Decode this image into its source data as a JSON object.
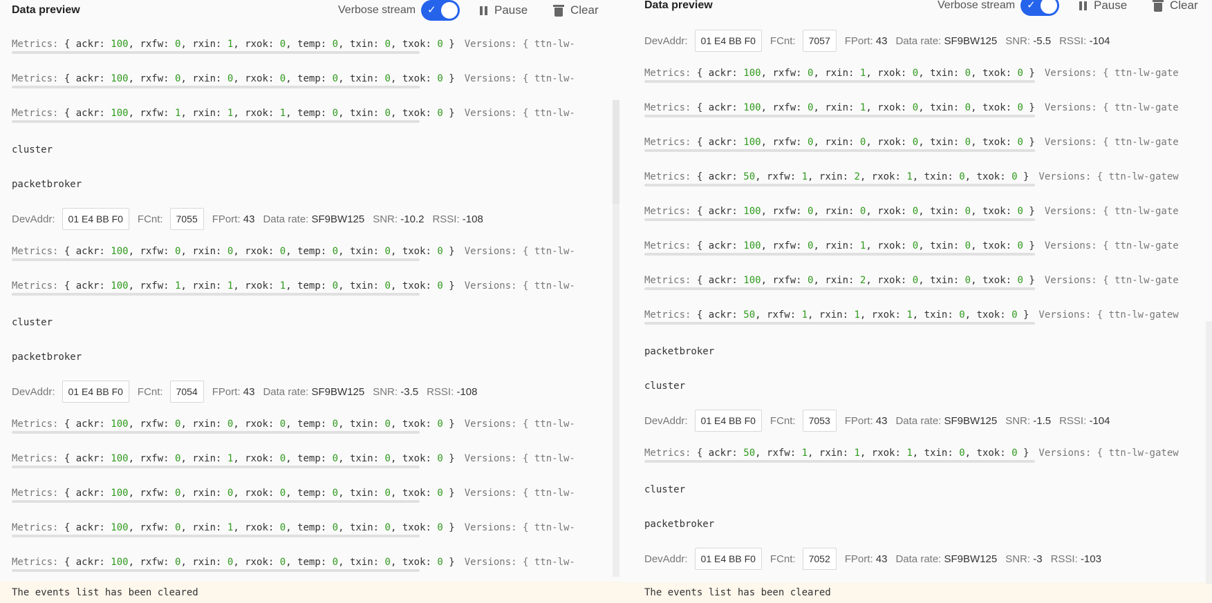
{
  "left_pane": {
    "title": "Data preview",
    "verbose_label": "Verbose stream",
    "pause_label": "Pause",
    "clear_label": "Clear",
    "notice": "The events list has been cleared",
    "events": [
      {
        "type": "metrics",
        "ackr": "100",
        "rxfw": "0",
        "rxin": "1",
        "rxok": "0",
        "temp": "0",
        "txin": "0",
        "txok": "0",
        "versions": "Versions: { ttn-lw-"
      },
      {
        "type": "metrics",
        "ackr": "100",
        "rxfw": "0",
        "rxin": "0",
        "rxok": "0",
        "temp": "0",
        "txin": "0",
        "txok": "0",
        "versions": "Versions: { ttn-lw-"
      },
      {
        "type": "metrics",
        "ackr": "100",
        "rxfw": "1",
        "rxin": "1",
        "rxok": "1",
        "temp": "0",
        "txin": "0",
        "txok": "0",
        "versions": "Versions: { ttn-lw-"
      },
      {
        "type": "text",
        "text": "cluster"
      },
      {
        "type": "text",
        "text": "packetbroker"
      },
      {
        "type": "dev",
        "devaddr": "01 E4 BB F0",
        "fcnt": "7055",
        "fport": "43",
        "datarate": "SF9BW125",
        "snr": "-10.2",
        "rssi": "-108"
      },
      {
        "type": "metrics",
        "ackr": "100",
        "rxfw": "0",
        "rxin": "0",
        "rxok": "0",
        "temp": "0",
        "txin": "0",
        "txok": "0",
        "versions": "Versions: { ttn-lw-"
      },
      {
        "type": "metrics",
        "ackr": "100",
        "rxfw": "1",
        "rxin": "1",
        "rxok": "1",
        "temp": "0",
        "txin": "0",
        "txok": "0",
        "versions": "Versions: { ttn-lw-"
      },
      {
        "type": "text",
        "text": "cluster"
      },
      {
        "type": "text",
        "text": "packetbroker"
      },
      {
        "type": "dev",
        "devaddr": "01 E4 BB F0",
        "fcnt": "7054",
        "fport": "43",
        "datarate": "SF9BW125",
        "snr": "-3.5",
        "rssi": "-108"
      },
      {
        "type": "metrics",
        "ackr": "100",
        "rxfw": "0",
        "rxin": "0",
        "rxok": "0",
        "temp": "0",
        "txin": "0",
        "txok": "0",
        "versions": "Versions: { ttn-lw-"
      },
      {
        "type": "metrics",
        "ackr": "100",
        "rxfw": "0",
        "rxin": "1",
        "rxok": "0",
        "temp": "0",
        "txin": "0",
        "txok": "0",
        "versions": "Versions: { ttn-lw-"
      },
      {
        "type": "metrics",
        "ackr": "100",
        "rxfw": "0",
        "rxin": "0",
        "rxok": "0",
        "temp": "0",
        "txin": "0",
        "txok": "0",
        "versions": "Versions: { ttn-lw-"
      },
      {
        "type": "metrics",
        "ackr": "100",
        "rxfw": "0",
        "rxin": "1",
        "rxok": "0",
        "temp": "0",
        "txin": "0",
        "txok": "0",
        "versions": "Versions: { ttn-lw-"
      },
      {
        "type": "metrics",
        "ackr": "100",
        "rxfw": "0",
        "rxin": "0",
        "rxok": "0",
        "temp": "0",
        "txin": "0",
        "txok": "0",
        "versions": "Versions: { ttn-lw-"
      }
    ]
  },
  "right_pane": {
    "title": "Data preview",
    "verbose_label": "Verbose stream",
    "pause_label": "Pause",
    "clear_label": "Clear",
    "notice": "The events list has been cleared",
    "events": [
      {
        "type": "dev",
        "devaddr": "01 E4 BB F0",
        "fcnt": "7057",
        "fport": "43",
        "datarate": "SF9BW125",
        "snr": "-5.5",
        "rssi": "-104"
      },
      {
        "type": "metrics",
        "ackr": "100",
        "rxfw": "0",
        "rxin": "1",
        "rxok": "0",
        "txin": "0",
        "txok": "0",
        "versions": "Versions: { ttn-lw-gate"
      },
      {
        "type": "metrics",
        "ackr": "100",
        "rxfw": "0",
        "rxin": "1",
        "rxok": "0",
        "txin": "0",
        "txok": "0",
        "versions": "Versions: { ttn-lw-gate"
      },
      {
        "type": "metrics",
        "ackr": "100",
        "rxfw": "0",
        "rxin": "0",
        "rxok": "0",
        "txin": "0",
        "txok": "0",
        "versions": "Versions: { ttn-lw-gate"
      },
      {
        "type": "metrics",
        "ackr": "50",
        "rxfw": "1",
        "rxin": "2",
        "rxok": "1",
        "txin": "0",
        "txok": "0",
        "versions": "Versions: { ttn-lw-gatew"
      },
      {
        "type": "metrics",
        "ackr": "100",
        "rxfw": "0",
        "rxin": "0",
        "rxok": "0",
        "txin": "0",
        "txok": "0",
        "versions": "Versions: { ttn-lw-gate"
      },
      {
        "type": "metrics",
        "ackr": "100",
        "rxfw": "0",
        "rxin": "1",
        "rxok": "0",
        "txin": "0",
        "txok": "0",
        "versions": "Versions: { ttn-lw-gate"
      },
      {
        "type": "metrics",
        "ackr": "100",
        "rxfw": "0",
        "rxin": "2",
        "rxok": "0",
        "txin": "0",
        "txok": "0",
        "versions": "Versions: { ttn-lw-gate"
      },
      {
        "type": "metrics",
        "ackr": "50",
        "rxfw": "1",
        "rxin": "1",
        "rxok": "1",
        "txin": "0",
        "txok": "0",
        "versions": "Versions: { ttn-lw-gatew"
      },
      {
        "type": "text",
        "text": "packetbroker"
      },
      {
        "type": "text",
        "text": "cluster"
      },
      {
        "type": "dev",
        "devaddr": "01 E4 BB F0",
        "fcnt": "7053",
        "fport": "43",
        "datarate": "SF9BW125",
        "snr": "-1.5",
        "rssi": "-104"
      },
      {
        "type": "metrics",
        "ackr": "50",
        "rxfw": "1",
        "rxin": "1",
        "rxok": "1",
        "txin": "0",
        "txok": "0",
        "versions": "Versions: { ttn-lw-gatew"
      },
      {
        "type": "text",
        "text": "cluster"
      },
      {
        "type": "text",
        "text": "packetbroker"
      },
      {
        "type": "dev",
        "devaddr": "01 E4 BB F0",
        "fcnt": "7052",
        "fport": "43",
        "datarate": "SF9BW125",
        "snr": "-3",
        "rssi": "-103"
      }
    ]
  }
}
